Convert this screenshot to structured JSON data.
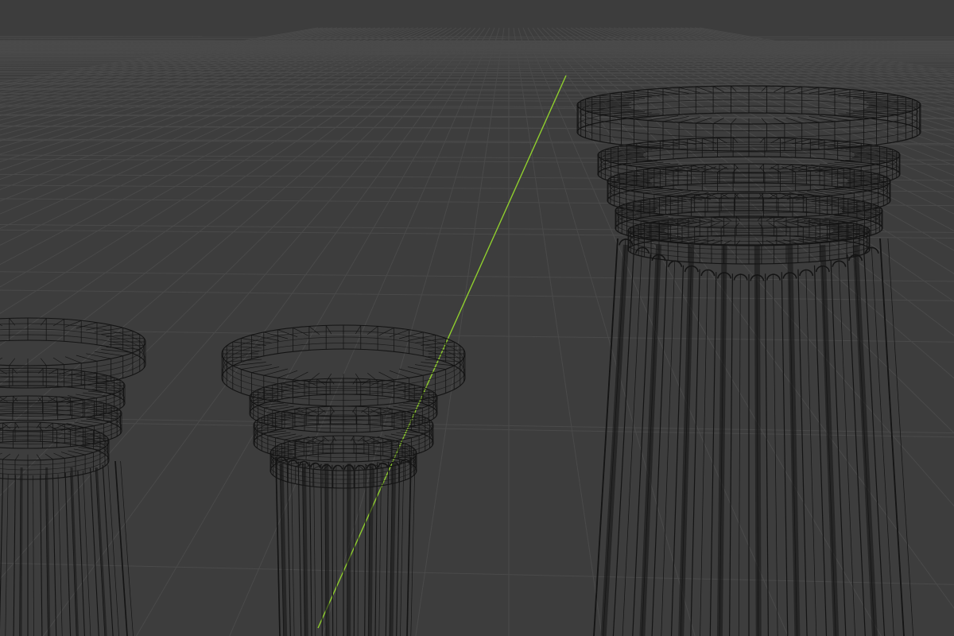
{
  "viewport": {
    "view_mode": "wireframe",
    "background_color": "#3d3d3d",
    "grid_color": "#4a4a4a",
    "y_axis_color": "#8fce2e",
    "wire_color": "#141414"
  },
  "scene_objects": [
    {
      "name": "column-left",
      "type": "column",
      "part_visible": "capital-and-partial-shaft"
    },
    {
      "name": "column-middle",
      "type": "column",
      "part_visible": "capital-and-shaft"
    },
    {
      "name": "column-right",
      "type": "column",
      "part_visible": "capital-and-shaft"
    }
  ]
}
